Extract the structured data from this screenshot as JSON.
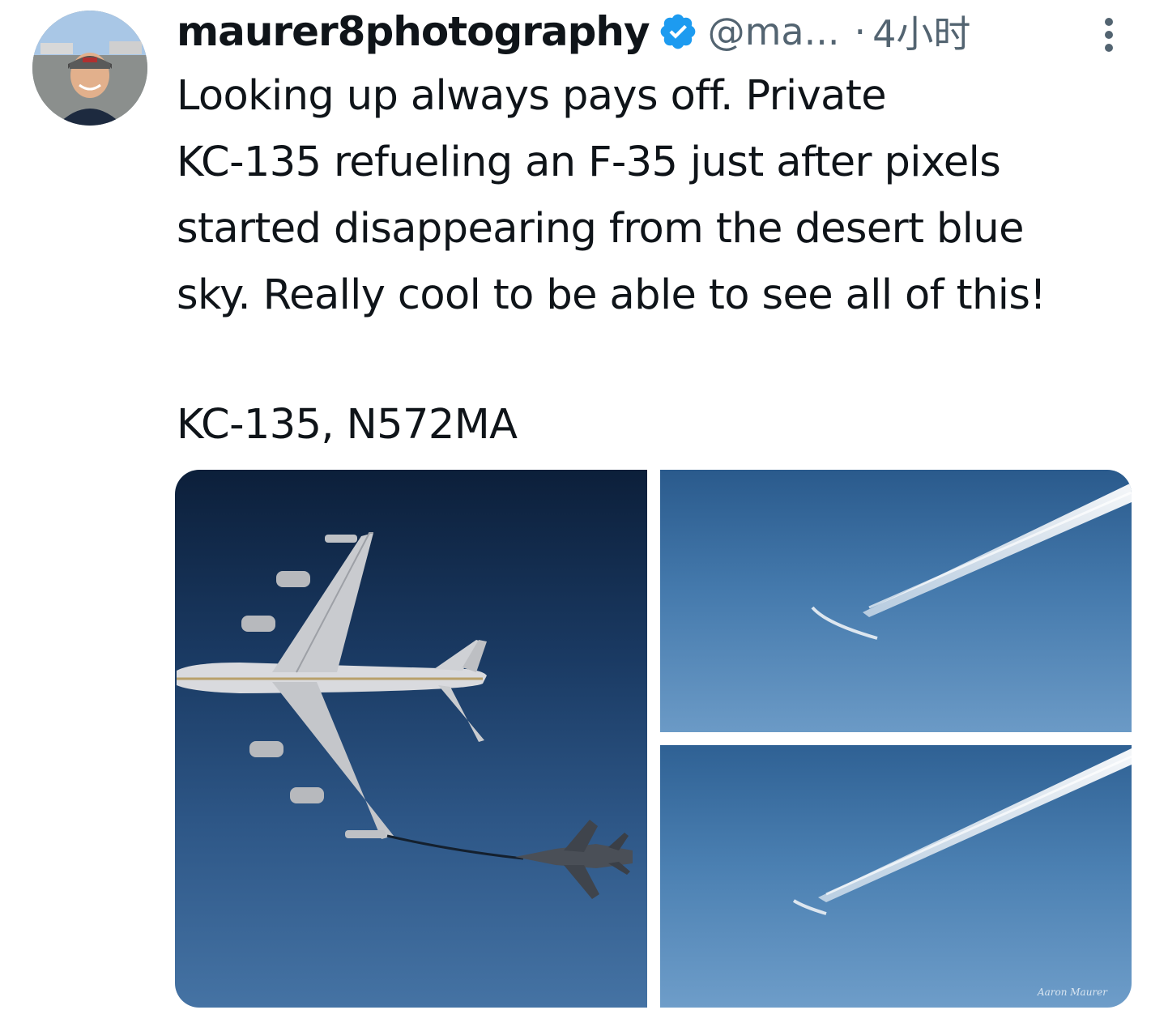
{
  "tweet": {
    "display_name": "maurer8photography",
    "handle": "@ma...",
    "separator": "·",
    "timestamp": "4小时",
    "text": "Looking up always pays off.  Private\nKC-135 refueling an F-35 just after pixels\nstarted disappearing from the desert blue\nsky.  Really cool to be able to see all of this!",
    "text_line2": "KC-135, N572MA",
    "verified": true,
    "badge_color": "#1d9bf0"
  },
  "media": {
    "count": 3,
    "photos": [
      {
        "subject": "kc-135-refueling-f-35"
      },
      {
        "subject": "contrail-and-f-35"
      },
      {
        "subject": "contrail-and-f-35",
        "watermark": "Aaron Maurer"
      }
    ]
  },
  "icons": {
    "verified": "verified-badge-icon",
    "more": "more-vertical-icon"
  }
}
